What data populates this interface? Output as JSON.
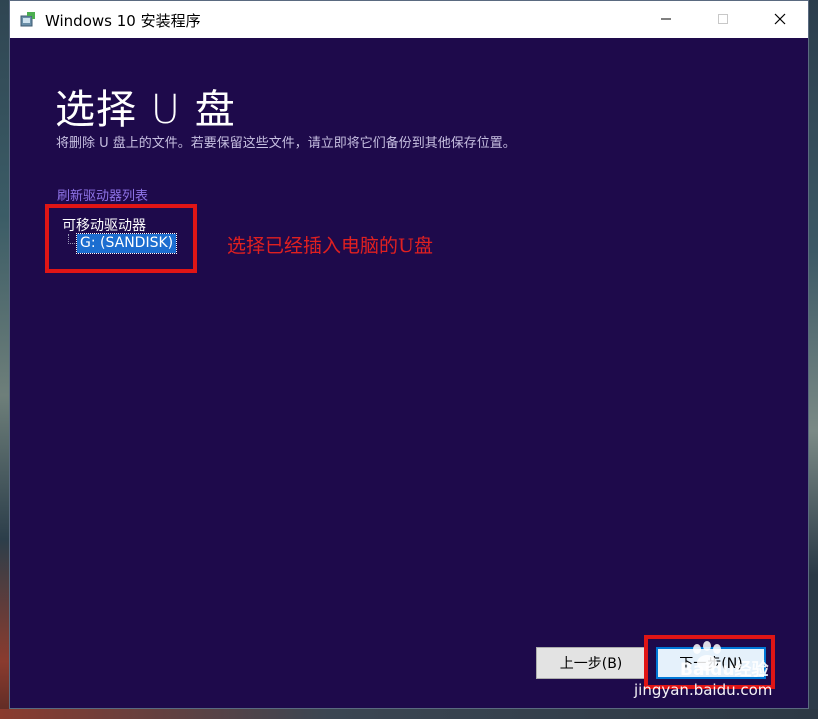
{
  "window": {
    "title": "Windows 10 安装程序"
  },
  "page": {
    "title": "选择 U 盘",
    "subtitle": "将删除 U 盘上的文件。若要保留这些文件，请立即将它们备份到其他保存位置。",
    "refresh_link": "刷新驱动器列表"
  },
  "drive_tree": {
    "root_label": "可移动驱动器",
    "items": [
      {
        "label": "G: (SANDISK)",
        "selected": true
      }
    ]
  },
  "annotation": {
    "text": "选择已经插入电脑的U盘",
    "color": "#e02020"
  },
  "footer": {
    "back_label": "上一步(B)",
    "next_label": "下一步(N)"
  },
  "watermark": {
    "brand": "Baidu经验",
    "url": "jingyan.baidu.com"
  },
  "colors": {
    "background": "#1e0a4b",
    "link": "#8f74e8",
    "selection": "#1c6ed0",
    "highlight_box": "#e01515"
  },
  "icons": {
    "app": "setup-icon",
    "minimize": "minimize-icon",
    "maximize": "maximize-icon",
    "close": "close-icon"
  }
}
